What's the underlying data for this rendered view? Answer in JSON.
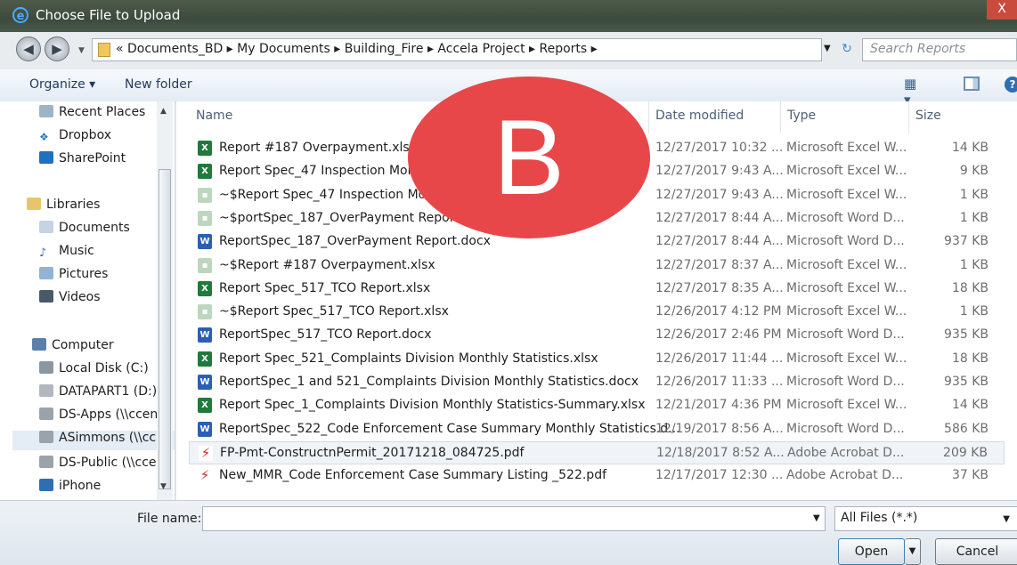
{
  "window": {
    "title": "Choose File to Upload",
    "close": "X"
  },
  "address": {
    "breadcrumbs": "« Documents_BD ▸ My Documents ▸ Building_Fire ▸ Accela Project ▸ Reports ▸",
    "search_placeholder": "Search Reports"
  },
  "toolbar": {
    "organize": "Organize ▾",
    "new_folder": "New folder"
  },
  "sidebar": {
    "items": [
      {
        "label": "Recent Places"
      },
      {
        "label": "Dropbox"
      },
      {
        "label": "SharePoint"
      },
      {
        "label": "Libraries"
      },
      {
        "label": "Documents"
      },
      {
        "label": "Music"
      },
      {
        "label": "Pictures"
      },
      {
        "label": "Videos"
      },
      {
        "label": "Computer"
      },
      {
        "label": "Local Disk (C:)"
      },
      {
        "label": "DATAPART1 (D:)"
      },
      {
        "label": "DS-Apps (\\\\ccen"
      },
      {
        "label": "ASimmons (\\\\cc"
      },
      {
        "label": "DS-Public (\\\\cce"
      },
      {
        "label": "iPhone"
      }
    ]
  },
  "columns": {
    "name": "Name",
    "date": "Date modified",
    "type": "Type",
    "size": "Size"
  },
  "files": [
    {
      "name": "Report #187 Overpayment.xlsx",
      "date": "12/27/2017 10:32 ...",
      "type": "Microsoft Excel W...",
      "size": "14 KB",
      "kind": "xlsx"
    },
    {
      "name": "Report Spec_47 Inspection Monthl",
      "date": "12/27/2017 9:43 A...",
      "type": "Microsoft Excel W...",
      "size": "9 KB",
      "kind": "xlsx"
    },
    {
      "name": "~$Report Spec_47 Inspection Mont",
      "date": "12/27/2017 9:43 A...",
      "type": "Microsoft Excel W...",
      "size": "1 KB",
      "kind": "tmp"
    },
    {
      "name": "~$portSpec_187_OverPayment Report.d",
      "date": "12/27/2017 8:44 A...",
      "type": "Microsoft Word D...",
      "size": "1 KB",
      "kind": "tmp"
    },
    {
      "name": "ReportSpec_187_OverPayment Report.docx",
      "date": "12/27/2017 8:44 A...",
      "type": "Microsoft Word D...",
      "size": "937 KB",
      "kind": "docx"
    },
    {
      "name": "~$Report #187 Overpayment.xlsx",
      "date": "12/27/2017 8:37 A...",
      "type": "Microsoft Excel W...",
      "size": "1 KB",
      "kind": "tmp"
    },
    {
      "name": "Report Spec_517_TCO Report.xlsx",
      "date": "12/27/2017 8:35 A...",
      "type": "Microsoft Excel W...",
      "size": "18 KB",
      "kind": "xlsx"
    },
    {
      "name": "~$Report Spec_517_TCO Report.xlsx",
      "date": "12/26/2017 4:12 PM",
      "type": "Microsoft Excel W...",
      "size": "1 KB",
      "kind": "tmp"
    },
    {
      "name": "ReportSpec_517_TCO Report.docx",
      "date": "12/26/2017 2:46 PM",
      "type": "Microsoft Word D...",
      "size": "935 KB",
      "kind": "docx"
    },
    {
      "name": "Report Spec_521_Complaints Division Monthly Statistics.xlsx",
      "date": "12/26/2017 11:44 ...",
      "type": "Microsoft Excel W...",
      "size": "18 KB",
      "kind": "xlsx"
    },
    {
      "name": "ReportSpec_1 and 521_Complaints Division Monthly Statistics.docx",
      "date": "12/26/2017 11:33 ...",
      "type": "Microsoft Word D...",
      "size": "935 KB",
      "kind": "docx"
    },
    {
      "name": "Report Spec_1_Complaints Division Monthly Statistics-Summary.xlsx",
      "date": "12/21/2017 4:36 PM",
      "type": "Microsoft Excel W...",
      "size": "14 KB",
      "kind": "xlsx"
    },
    {
      "name": "ReportSpec_522_Code Enforcement Case Summary Monthly Statistics.d...",
      "date": "12/19/2017 8:56 A...",
      "type": "Microsoft Word D...",
      "size": "586 KB",
      "kind": "docx"
    },
    {
      "name": "FP-Pmt-ConstructnPermit_20171218_084725.pdf",
      "date": "12/18/2017 8:52 A...",
      "type": "Adobe Acrobat D...",
      "size": "209 KB",
      "kind": "pdf"
    },
    {
      "name": "New_MMR_Code Enforcement Case Summary Listing _522.pdf",
      "date": "12/17/2017 12:30 ...",
      "type": "Adobe Acrobat D...",
      "size": "37 KB",
      "kind": "pdf"
    }
  ],
  "overlay": {
    "letter": "B",
    "color": "#e8474a"
  },
  "footer": {
    "file_name_label": "File name:",
    "file_name_value": "",
    "filter": "All Files (*.*)",
    "open": "Open",
    "cancel": "Cancel"
  },
  "colors": {
    "accent": "#2f6db5",
    "titlebar": "#3c4a3e"
  }
}
